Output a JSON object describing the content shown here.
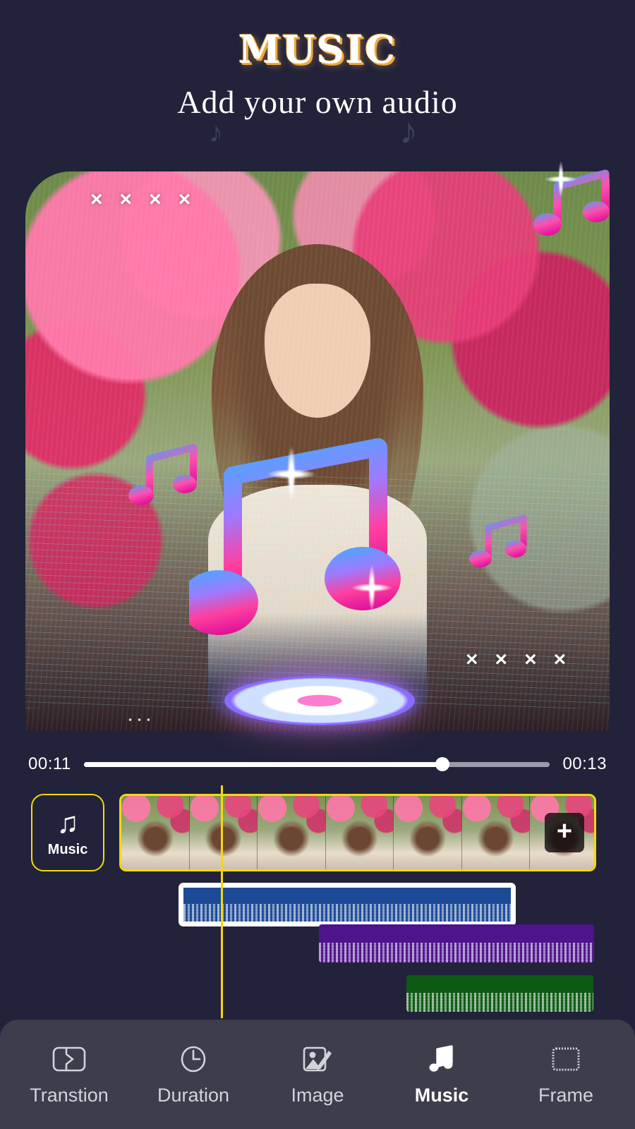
{
  "header": {
    "title": "MUSIC",
    "subtitle": "Add your own audio",
    "title_glow_color": "#f0a93c",
    "deco_note_left": "♪",
    "deco_note_right": "♪"
  },
  "preview": {
    "overlay_marks_top_left": [
      "×",
      "×",
      "×",
      "×"
    ],
    "overlay_marks_bottom_right": [
      "×",
      "×",
      "×",
      "×"
    ],
    "sticker_names": [
      "music-note-large",
      "music-note-medium",
      "music-note-top-right",
      "music-note-small",
      "glow-disc",
      "sparkle"
    ]
  },
  "progress": {
    "current_time": "00:11",
    "total_time": "00:13",
    "percent": 77
  },
  "timeline": {
    "music_button": {
      "label": "Music",
      "icon": "♫",
      "border_color": "#f5d90a"
    },
    "filmstrip": {
      "frame_count": 7,
      "border_color": "#f5d90a"
    },
    "add_button": {
      "label": "+"
    },
    "playhead_color": "#f5d90a",
    "audio_clips": [
      {
        "name": "clip-blue",
        "color": "#1c4a96",
        "selected": true
      },
      {
        "name": "clip-purple",
        "color": "#4d148c",
        "selected": false
      },
      {
        "name": "clip-green",
        "color": "#0d5a14",
        "selected": false
      }
    ]
  },
  "navbar": {
    "items": [
      {
        "label": "Transtion",
        "icon": "transition-icon",
        "active": false
      },
      {
        "label": "Duration",
        "icon": "clock-icon",
        "active": false
      },
      {
        "label": "Image",
        "icon": "image-edit-icon",
        "active": false
      },
      {
        "label": "Music",
        "icon": "music-note-icon",
        "active": true
      },
      {
        "label": "Frame",
        "icon": "frame-icon",
        "active": false
      }
    ]
  }
}
